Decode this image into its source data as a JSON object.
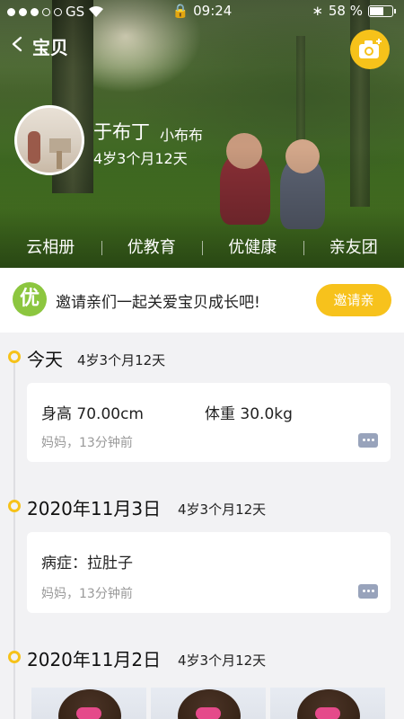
{
  "status_bar": {
    "carrier": "GS",
    "time": "09:24",
    "battery": "58 %",
    "battery_level": 0.58
  },
  "header": {
    "title": "宝贝"
  },
  "profile": {
    "name": "于布丁",
    "nickname": "小布布",
    "age": "4岁3个月12天"
  },
  "hero_tabs": [
    {
      "label": "云相册"
    },
    {
      "label": "优教育"
    },
    {
      "label": "优健康"
    },
    {
      "label": "亲友团"
    }
  ],
  "invite": {
    "logo_text": "优",
    "text": "邀请亲们一起关爱宝贝成长吧!",
    "button_label": "邀请亲"
  },
  "timeline": [
    {
      "date": "今天",
      "age": "4岁3个月12天",
      "card": {
        "height_label": "身高",
        "height_value": "70.00cm",
        "weight_label": "体重",
        "weight_value": "30.0kg",
        "meta": "妈妈，13分钟前"
      }
    },
    {
      "date": "2020年11月3日",
      "age": "4岁3个月12天",
      "card": {
        "text": "病症：拉肚子",
        "meta": "妈妈，13分钟前"
      }
    },
    {
      "date": "2020年11月2日",
      "age": "4岁3个月12天"
    }
  ],
  "colors": {
    "accent": "#f6c21a",
    "invite_logo": "#8cc63f",
    "meta_text": "#999999"
  }
}
